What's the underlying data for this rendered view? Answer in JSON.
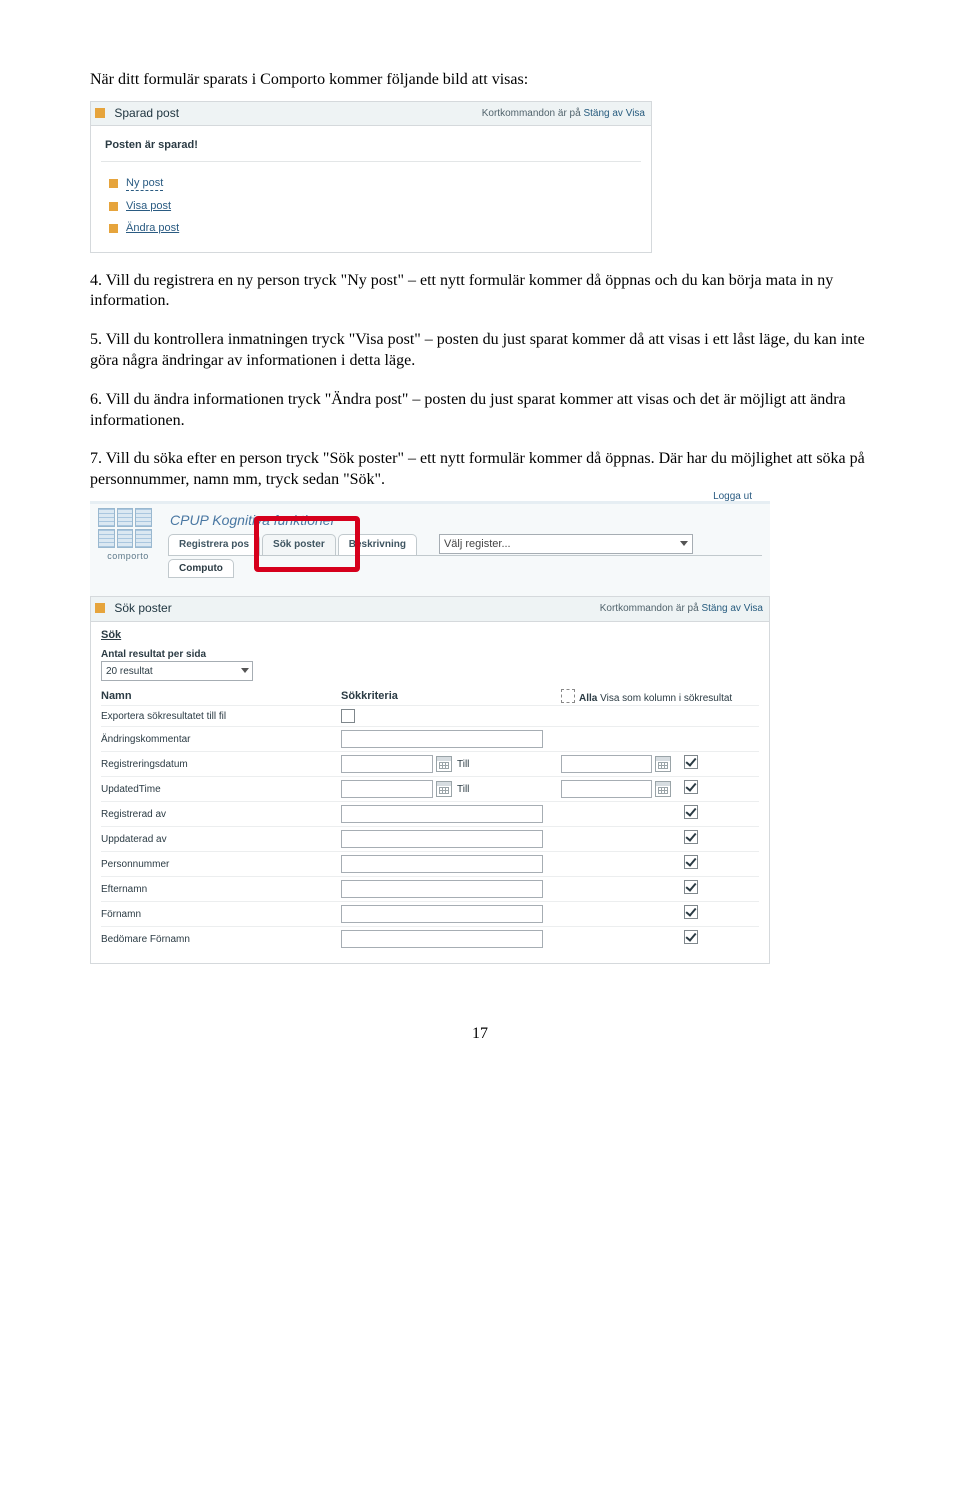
{
  "intro_text": "När ditt formulär sparats i Comporto kommer följande bild att visas:",
  "panel1": {
    "title": "Sparad post",
    "right_text_prefix": "Kortkommandon är på ",
    "right_text_link1": "Stäng av",
    "right_text_link2": "Visa",
    "saved_msg": "Posten är sparad!",
    "links": [
      "Ny post",
      "Visa post",
      "Ändra post"
    ]
  },
  "paragraphs": {
    "p4": "4. Vill du registrera en ny person tryck \"Ny post\" – ett nytt formulär kommer då öppnas och du kan börja mata in ny information.",
    "p5": "5. Vill du kontrollera inmatningen tryck \"Visa post\" – posten du just sparat kommer då att visas i ett låst läge, du kan inte göra några ändringar av informationen i detta läge.",
    "p6": "6. Vill du ändra informationen tryck \"Ändra post\" – posten du just sparat kommer att visas och det är möjligt att ändra informationen.",
    "p7": "7. Vill du söka efter en person tryck \"Sök poster\" – ett nytt formulär kommer då öppnas. Där har du möjlighet att söka på personnummer, namn mm, tryck sedan \"Sök\"."
  },
  "nav": {
    "app_title": "CPUP Kognitiva funktioner",
    "logout": "Logga ut",
    "tabs": [
      "Registrera pos",
      "Sök poster",
      "Beskrivning"
    ],
    "register_select_label": "Välj register...",
    "sub_tab": "Computo",
    "logo_text": "comporto"
  },
  "search": {
    "panel_title": "Sök poster",
    "right_text_prefix": "Kortkommandon är på ",
    "right_text_link1": "Stäng av",
    "right_text_link2": "Visa",
    "sok_label": "Sök",
    "per_page_label": "Antal resultat per sida",
    "per_page_value": "20 resultat",
    "col_name": "Namn",
    "col_crit": "Sökkriteria",
    "col_vis_label_strong1": "Alla",
    "col_vis_label_rest": " Visa som kolumn i sökresultat",
    "rows": [
      {
        "name": "Exportera sökresultatet till fil",
        "type": "blank_cb"
      },
      {
        "name": "Ändringskommentar",
        "type": "wide"
      },
      {
        "name": "Registreringsdatum",
        "type": "daterange",
        "checked": true
      },
      {
        "name": "UpdatedTime",
        "type": "daterange",
        "checked": true
      },
      {
        "name": "Registrerad av",
        "type": "wide",
        "checked": true
      },
      {
        "name": "Uppdaterad av",
        "type": "wide",
        "checked": true
      },
      {
        "name": "Personnummer",
        "type": "wide",
        "checked": true
      },
      {
        "name": "Efternamn",
        "type": "wide",
        "checked": true
      },
      {
        "name": "Förnamn",
        "type": "wide",
        "checked": true
      },
      {
        "name": "Bedömare Förnamn",
        "type": "wide",
        "checked": true
      }
    ],
    "till_label": "Till"
  },
  "page_number": "17"
}
